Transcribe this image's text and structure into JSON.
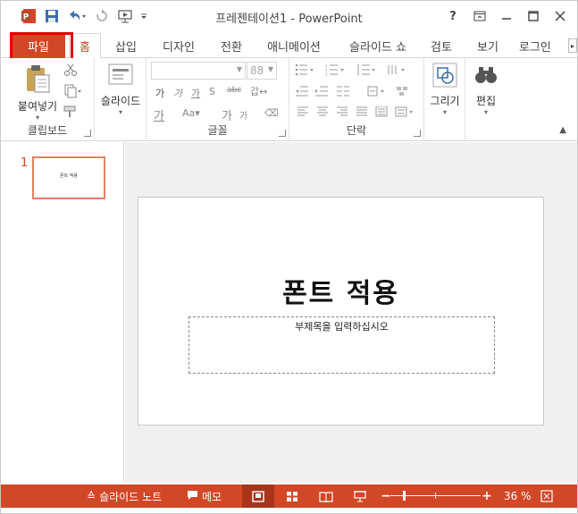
{
  "app": {
    "window_title": "프레젠테이션1 - PowerPoint",
    "help": "?",
    "accent": "#d24726"
  },
  "tabs": [
    {
      "label": "파일"
    },
    {
      "label": "홈"
    },
    {
      "label": "삽입"
    },
    {
      "label": "디자인"
    },
    {
      "label": "전환"
    },
    {
      "label": "애니메이션"
    },
    {
      "label": "슬라이드 쇼"
    },
    {
      "label": "검토"
    },
    {
      "label": "보기"
    },
    {
      "label": "로그인"
    }
  ],
  "ribbon": {
    "clipboard": {
      "paste_label": "붙여넣기",
      "group_label": "클립보드"
    },
    "slides": {
      "slide_label": "슬라이드"
    },
    "font": {
      "size_value": "88",
      "group_label": "글꼴",
      "bold_glyph": "가",
      "shrink_glyph": "가"
    },
    "paragraph": {
      "group_label": "단락"
    },
    "drawing": {
      "label": "그리기"
    },
    "editing": {
      "label": "편집"
    }
  },
  "thumbnails": [
    {
      "number": "1",
      "text": "폰트 적용"
    }
  ],
  "slide": {
    "title": "폰트 적용",
    "subtitle_placeholder": "부제목을 입력하십시오"
  },
  "statusbar": {
    "notes_label": "슬라이드 노트",
    "comments_label": "메모",
    "zoom_minus": "−",
    "zoom_plus": "+",
    "zoom_value": "36 %",
    "zoom_level": 0.36
  }
}
